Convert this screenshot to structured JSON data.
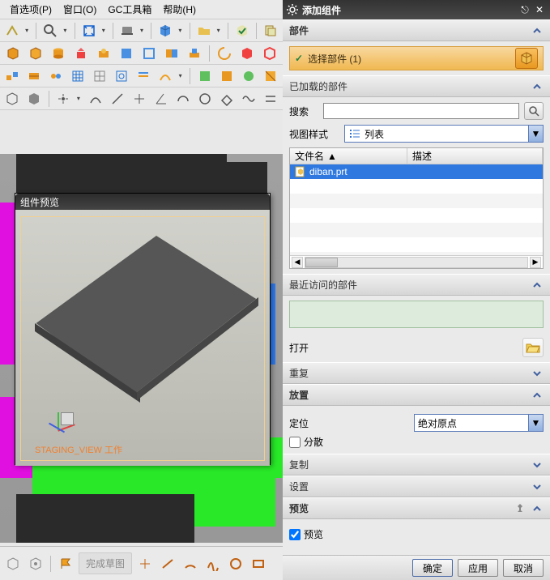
{
  "menu": {
    "prefs": "首选项(P)",
    "window": "窗口(O)",
    "toolbox": "GC工具箱",
    "help": "帮助(H)"
  },
  "preview": {
    "title": "组件预览",
    "staging": "STAGING_VIEW 工作"
  },
  "sketch": {
    "finish": "完成草图"
  },
  "dialog": {
    "title": "添加组件",
    "sections": {
      "part": "部件",
      "select_part": "选择部件 (1)",
      "loaded": "已加载的部件",
      "recent": "最近访问的部件",
      "open": "打开",
      "repeat": "重复",
      "placement": "放置",
      "copy": "复制",
      "settings": "设置",
      "preview": "预览"
    },
    "search_label": "搜索",
    "viewstyle_label": "视图样式",
    "viewstyle_value": "列表",
    "file_cols": {
      "name": "文件名",
      "desc": "描述"
    },
    "files": [
      {
        "name": "diban.prt",
        "desc": ""
      }
    ],
    "placement_label": "定位",
    "placement_value": "绝对原点",
    "scatter": "分散",
    "preview_chk": "预览",
    "buttons": {
      "ok": "确定",
      "apply": "应用",
      "cancel": "取消"
    }
  }
}
